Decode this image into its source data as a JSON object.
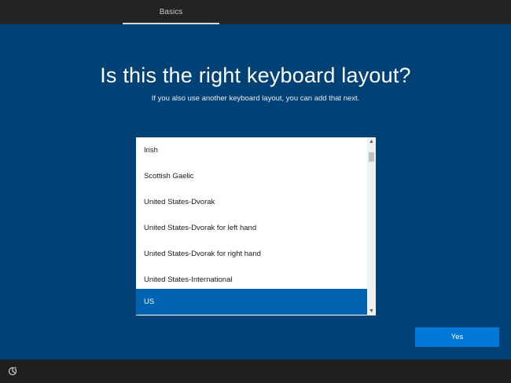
{
  "header": {
    "tab_label": "Basics"
  },
  "main": {
    "title": "Is this the right keyboard layout?",
    "subtitle": "If you also use another keyboard layout, you can add that next.",
    "layouts": [
      {
        "label": "Irish",
        "selected": false
      },
      {
        "label": "Scottish Gaelic",
        "selected": false
      },
      {
        "label": "United States-Dvorak",
        "selected": false
      },
      {
        "label": "United States-Dvorak for left hand",
        "selected": false
      },
      {
        "label": "United States-Dvorak for right hand",
        "selected": false
      },
      {
        "label": "United States-International",
        "selected": false
      },
      {
        "label": "US",
        "selected": true
      }
    ],
    "yes_label": "Yes"
  },
  "footer": {
    "accessibility_icon": "ease-of-access-icon"
  },
  "colors": {
    "accent": "#0078d7",
    "selection": "#0063b1",
    "background": "#004275"
  }
}
